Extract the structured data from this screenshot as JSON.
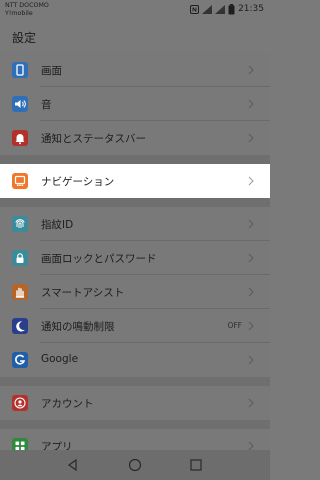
{
  "status_bar": {
    "carrier_line1": "NTT DOCOMO",
    "carrier_line2": "Y!mobile",
    "time": "21:35"
  },
  "title": "設定",
  "items": [
    {
      "label": "画面",
      "icon": "display-icon",
      "color": "#2f6fb8"
    },
    {
      "label": "音",
      "icon": "sound-icon",
      "color": "#2f6fb8"
    },
    {
      "label": "通知とステータスバー",
      "icon": "bell-icon",
      "color": "#b4302a"
    },
    {
      "label": "ナビゲーション",
      "icon": "navigation-icon",
      "color": "#f0782d",
      "highlighted": true
    },
    {
      "label": "指紋ID",
      "icon": "fingerprint-icon",
      "color": "#3a8c9a"
    },
    {
      "label": "画面ロックとパスワード",
      "icon": "lock-icon",
      "color": "#3a8c9a"
    },
    {
      "label": "スマートアシスト",
      "icon": "hand-icon",
      "color": "#b5642a"
    },
    {
      "label": "通知の鳴動制限",
      "icon": "moon-icon",
      "color": "#2a3f8c",
      "value": "OFF"
    },
    {
      "label": "Google",
      "icon": "google-icon",
      "color": "#1f5fa8"
    },
    {
      "label": "アカウント",
      "icon": "account-icon",
      "color": "#b4302a"
    },
    {
      "label": "アプリ",
      "icon": "apps-icon",
      "color": "#2f8a3e"
    }
  ]
}
